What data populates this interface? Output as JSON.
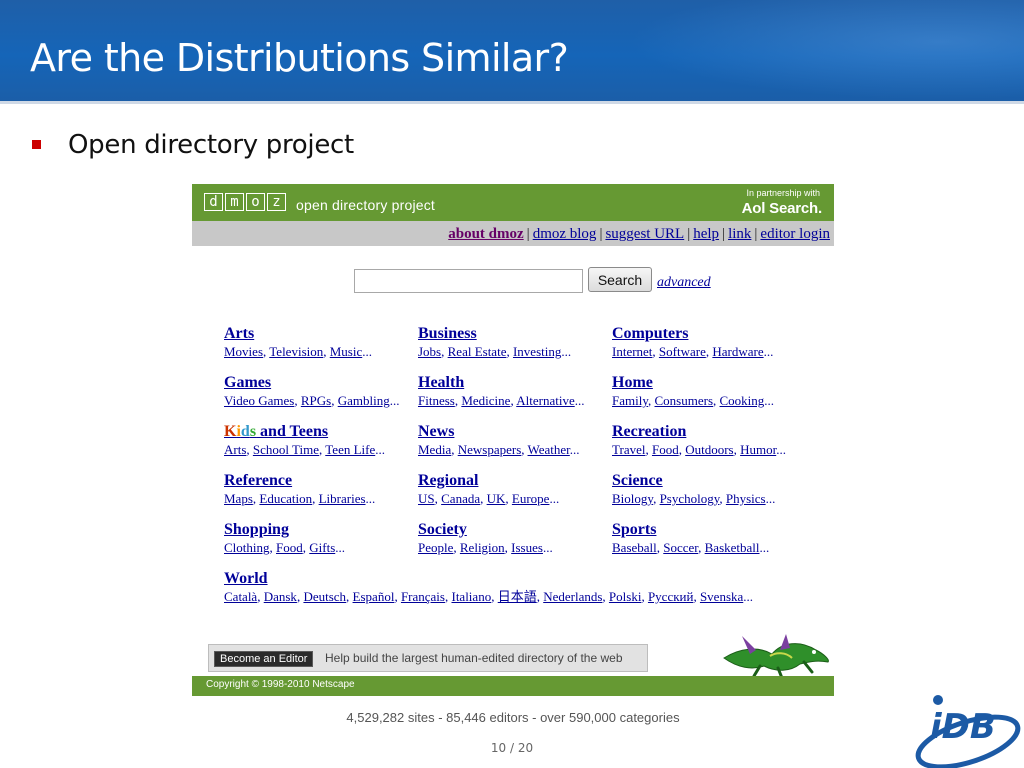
{
  "slide": {
    "title": "Are the Distributions Similar?",
    "bullet": "Open directory project",
    "page_number": "10 / 20"
  },
  "dmoz": {
    "logo_letters": [
      "d",
      "m",
      "o",
      "z"
    ],
    "tagline": "open directory project",
    "partner_small": "In partnership with",
    "partner_big": "Aol Search.",
    "top_links": [
      "about dmoz",
      "dmoz blog",
      "suggest URL",
      "help",
      "link",
      "editor login"
    ],
    "search_button": "Search",
    "search_value": "",
    "advanced_link": "advanced",
    "categories": [
      {
        "name": "Arts",
        "subs": [
          "Movies",
          "Television",
          "Music"
        ]
      },
      {
        "name": "Business",
        "subs": [
          "Jobs",
          "Real Estate",
          "Investing"
        ]
      },
      {
        "name": "Computers",
        "subs": [
          "Internet",
          "Software",
          "Hardware"
        ]
      },
      {
        "name": "Games",
        "subs": [
          "Video Games",
          "RPGs",
          "Gambling"
        ]
      },
      {
        "name": "Health",
        "subs": [
          "Fitness",
          "Medicine",
          "Alternative"
        ]
      },
      {
        "name": "Home",
        "subs": [
          "Family",
          "Consumers",
          "Cooking"
        ]
      },
      {
        "name": "Kids and Teens",
        "subs": [
          "Arts",
          "School Time",
          "Teen Life"
        ]
      },
      {
        "name": "News",
        "subs": [
          "Media",
          "Newspapers",
          "Weather"
        ]
      },
      {
        "name": "Recreation",
        "subs": [
          "Travel",
          "Food",
          "Outdoors",
          "Humor"
        ]
      },
      {
        "name": "Reference",
        "subs": [
          "Maps",
          "Education",
          "Libraries"
        ]
      },
      {
        "name": "Regional",
        "subs": [
          "US",
          "Canada",
          "UK",
          "Europe"
        ]
      },
      {
        "name": "Science",
        "subs": [
          "Biology",
          "Psychology",
          "Physics"
        ]
      },
      {
        "name": "Shopping",
        "subs": [
          "Clothing",
          "Food",
          "Gifts"
        ]
      },
      {
        "name": "Society",
        "subs": [
          "People",
          "Religion",
          "Issues"
        ]
      },
      {
        "name": "Sports",
        "subs": [
          "Baseball",
          "Soccer",
          "Basketball"
        ]
      },
      {
        "name": "World",
        "subs": [
          "Català",
          "Dansk",
          "Deutsch",
          "Español",
          "Français",
          "Italiano",
          "日本語",
          "Nederlands",
          "Polski",
          "Русский",
          "Svenska"
        ]
      }
    ],
    "become_editor": "Become an Editor",
    "help_build": "Help build the largest human-edited directory of the web",
    "copyright": "Copyright © 1998-2010 Netscape",
    "stats": "4,529,282 sites - 85,446 editors - over 590,000 categories"
  },
  "colors": {
    "title_bar": "#1b63b0",
    "dmoz_green": "#669933",
    "link_blue": "#000099",
    "bullet_red": "#cc0000"
  }
}
